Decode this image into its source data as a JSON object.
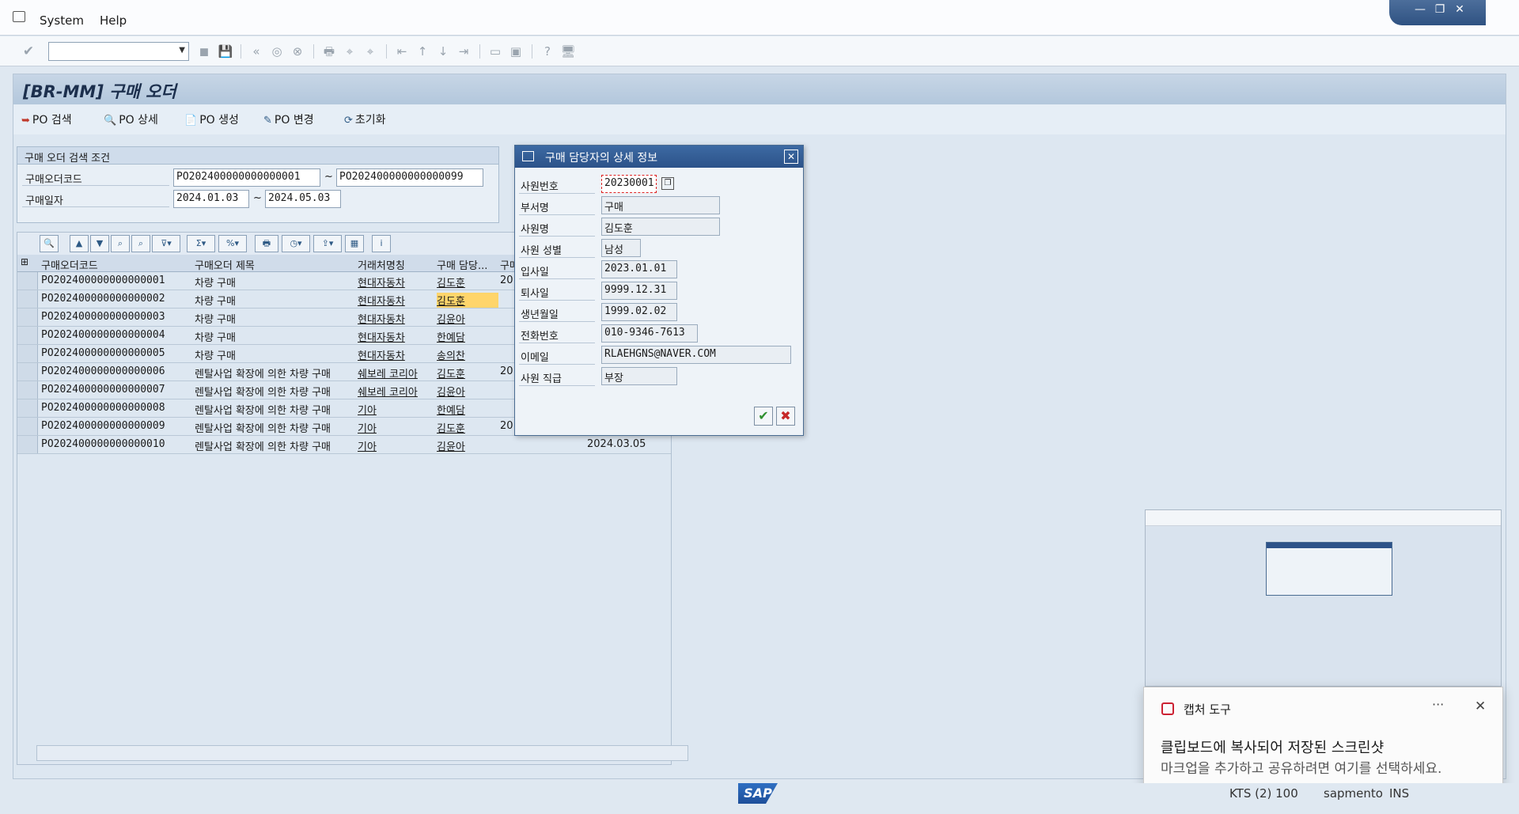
{
  "menu": {
    "system": "System",
    "help": "Help"
  },
  "window": {
    "min": "—",
    "restore": "❐",
    "close": "✕"
  },
  "toolbar": {
    "command_placeholder": ""
  },
  "title": "[BR-MM] 구매 오더",
  "app_buttons": [
    {
      "icon": "search-icon",
      "glyph": "➥",
      "label": "PO 검색"
    },
    {
      "icon": "detail-icon",
      "glyph": "🔍",
      "label": "PO 상세"
    },
    {
      "icon": "document-icon",
      "glyph": "📄",
      "label": "PO 생성"
    },
    {
      "icon": "pencil-icon",
      "glyph": "✎",
      "label": "PO 변경"
    },
    {
      "icon": "refresh-icon",
      "glyph": "⟳",
      "label": "초기화"
    }
  ],
  "search": {
    "header": "구매 오더 검색 조건",
    "po_code_label": "구매오더코드",
    "po_code_from": "PO202400000000000001",
    "po_code_to": "PO202400000000000099",
    "date_label": "구매일자",
    "date_from": "2024.01.03",
    "date_to": "2024.05.03",
    "tilde": "~"
  },
  "grid": {
    "headers": [
      "구매오더코드",
      "구매오더 제목",
      "거래처명칭",
      "구매 담당...",
      "구매"
    ],
    "rows": [
      {
        "code": "PO202400000000000001",
        "title": "차량 구매",
        "vendor": "현대자동차",
        "buyer": "김도훈",
        "date": "20"
      },
      {
        "code": "PO202400000000000002",
        "title": "차량 구매",
        "vendor": "현대자동차",
        "buyer": "김도훈",
        "date": ""
      },
      {
        "code": "PO202400000000000003",
        "title": "차량 구매",
        "vendor": "현대자동차",
        "buyer": "김윤아",
        "date": ""
      },
      {
        "code": "PO202400000000000004",
        "title": "차량 구매",
        "vendor": "현대자동차",
        "buyer": "한예담",
        "date": ""
      },
      {
        "code": "PO202400000000000005",
        "title": "차량 구매",
        "vendor": "현대자동차",
        "buyer": "송의찬",
        "date": ""
      },
      {
        "code": "PO202400000000000006",
        "title": "렌탈사업 확장에 의한 차량 구매",
        "vendor": "쉐보레 코리아",
        "buyer": "김도훈",
        "date": "20"
      },
      {
        "code": "PO202400000000000007",
        "title": "렌탈사업 확장에 의한 차량 구매",
        "vendor": "쉐보레 코리아",
        "buyer": "김윤아",
        "date": ""
      },
      {
        "code": "PO202400000000000008",
        "title": "렌탈사업 확장에 의한 차량 구매",
        "vendor": "기아",
        "buyer": "한예담",
        "date": ""
      },
      {
        "code": "PO202400000000000009",
        "title": "렌탈사업 확장에 의한 차량 구매",
        "vendor": "기아",
        "buyer": "김도훈",
        "date": "20"
      },
      {
        "code": "PO202400000000000010",
        "title": "렌탈사업 확장에 의한 차량 구매",
        "vendor": "기아",
        "buyer": "김윤아",
        "date": "2024.03.05"
      }
    ]
  },
  "dialog": {
    "title": "구매 담당자의 상세 정보",
    "fields": [
      {
        "label": "사원번호",
        "value": "20230001"
      },
      {
        "label": "부서명",
        "value": "구매"
      },
      {
        "label": "사원명",
        "value": "김도훈"
      },
      {
        "label": "사원 성별",
        "value": "남성"
      },
      {
        "label": "입사일",
        "value": "2023.01.01"
      },
      {
        "label": "퇴사일",
        "value": "9999.12.31"
      },
      {
        "label": "생년월일",
        "value": "1999.02.02"
      },
      {
        "label": "전화번호",
        "value": "010-9346-7613"
      },
      {
        "label": "이메일",
        "value": "RLAEHGNS@NAVER.COM"
      },
      {
        "label": "사원 직급",
        "value": "부장"
      }
    ]
  },
  "toast": {
    "app": "캡처 도구",
    "more": "···",
    "close": "✕",
    "line1": "클립보드에 복사되어 저장된 스크린샷",
    "line2": "마크업을 추가하고 공유하려면 여기를 선택하세요."
  },
  "status": {
    "logo": "SAP",
    "system": "KTS (2) 100",
    "user": "sapmento",
    "mode": "INS"
  },
  "colors": {
    "accent": "#2c5289",
    "highlight": "#ffd56b"
  }
}
